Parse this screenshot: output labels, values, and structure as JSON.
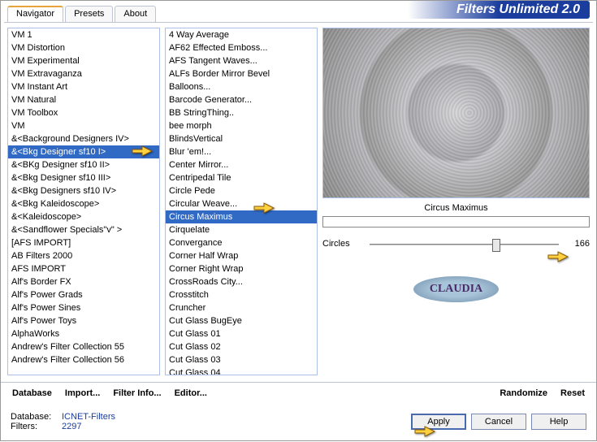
{
  "app_title": "Filters Unlimited 2.0",
  "tabs": [
    "Navigator",
    "Presets",
    "About"
  ],
  "active_tab": 0,
  "categories": [
    "VM 1",
    "VM Distortion",
    "VM Experimental",
    "VM Extravaganza",
    "VM Instant Art",
    "VM Natural",
    "VM Toolbox",
    "VM",
    "&<Background Designers IV>",
    "&<Bkg Designer sf10 I>",
    "&<BKg Designer sf10 II>",
    "&<Bkg Designer sf10 III>",
    "&<Bkg Designers sf10 IV>",
    "&<Bkg Kaleidoscope>",
    "&<Kaleidoscope>",
    "&<Sandflower Specials\"v\" >",
    "[AFS IMPORT]",
    "AB Filters 2000",
    "AFS IMPORT",
    "Alf's Border FX",
    "Alf's Power Grads",
    "Alf's Power Sines",
    "Alf's Power Toys",
    "AlphaWorks",
    "Andrew's Filter Collection 55",
    "Andrew's Filter Collection 56"
  ],
  "selected_category": 9,
  "filters": [
    "4 Way Average",
    "AF62 Effected Emboss...",
    "AFS Tangent Waves...",
    "ALFs Border Mirror Bevel",
    "Balloons...",
    "Barcode Generator...",
    "BB StringThing..",
    "bee morph",
    "BlindsVertical",
    "Blur 'em!...",
    "Center Mirror...",
    "Centripedal Tile",
    "Circle Pede",
    "Circular Weave...",
    "Circus Maximus",
    "Cirquelate",
    "Convergance",
    "Corner Half Wrap",
    "Corner Right Wrap",
    "CrossRoads City...",
    "Crosstitch",
    "Cruncher",
    "Cut Glass  BugEye",
    "Cut Glass 01",
    "Cut Glass 02",
    "Cut Glass 03",
    "Cut Glass 04"
  ],
  "selected_filter": 14,
  "preview_label": "Circus Maximus",
  "slider": {
    "label": "Circles",
    "value": "166",
    "position": 65
  },
  "watermark": "CLAUDIA",
  "toolbar": {
    "database": "Database",
    "import": "Import...",
    "filter_info": "Filter Info...",
    "editor": "Editor...",
    "randomize": "Randomize",
    "reset": "Reset"
  },
  "footer": {
    "db_label": "Database:",
    "db_value": "ICNET-Filters",
    "filters_label": "Filters:",
    "filters_value": "2297",
    "apply": "Apply",
    "cancel": "Cancel",
    "help": "Help"
  }
}
